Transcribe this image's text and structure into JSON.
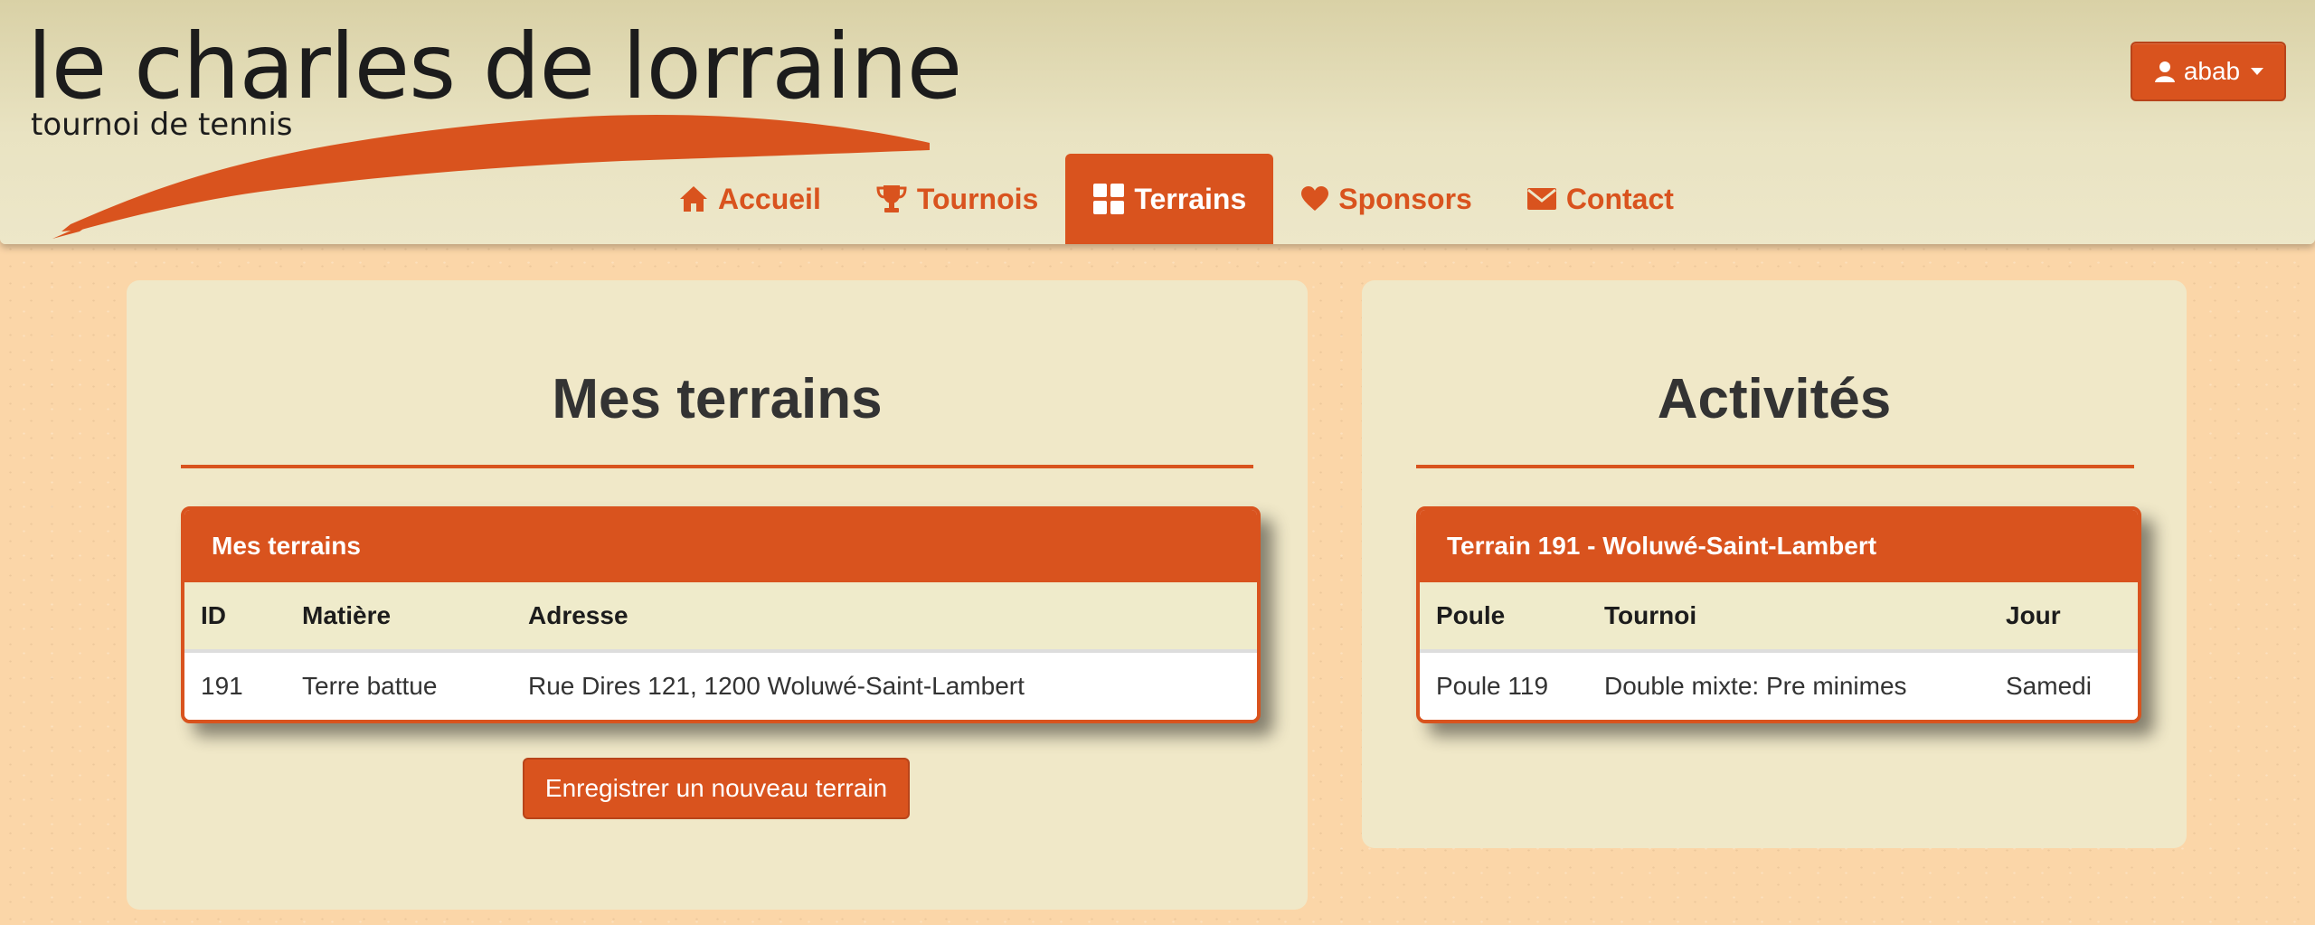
{
  "logo": {
    "title": "le charles de lorraine",
    "subtitle": "tournoi de tennis"
  },
  "user_menu": {
    "username": "abab",
    "icon": "user-icon"
  },
  "nav": {
    "items": [
      {
        "label": "Accueil",
        "icon": "home-icon",
        "active": false
      },
      {
        "label": "Tournois",
        "icon": "trophy-icon",
        "active": false
      },
      {
        "label": "Terrains",
        "icon": "grid-icon",
        "active": true
      },
      {
        "label": "Sponsors",
        "icon": "heart-icon",
        "active": false
      },
      {
        "label": "Contact",
        "icon": "envelope-icon",
        "active": false
      }
    ]
  },
  "left_panel": {
    "title": "Mes terrains",
    "card_title": "Mes terrains",
    "columns": [
      "ID",
      "Matière",
      "Adresse"
    ],
    "rows": [
      [
        "191",
        "Terre battue",
        "Rue Dires 121, 1200 Woluwé-Saint-Lambert"
      ]
    ],
    "new_button": "Enregistrer un nouveau terrain"
  },
  "right_panel": {
    "title": "Activités",
    "card_title": "Terrain 191 - Woluwé-Saint-Lambert",
    "columns": [
      "Poule",
      "Tournoi",
      "Jour"
    ],
    "rows": [
      [
        "Poule 119",
        "Double mixte: Pre minimes",
        "Samedi"
      ]
    ]
  },
  "colors": {
    "accent": "#d9531e",
    "header_bg": "#e9e3c2",
    "panel_bg": "#f0e8c8",
    "page_bg": "#fbd6a8"
  }
}
